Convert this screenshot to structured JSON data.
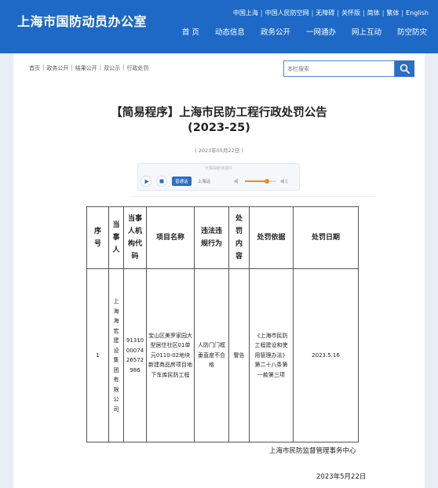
{
  "header": {
    "site_title": "上海市国防动员办公室",
    "top_links": [
      "中国上海",
      "中国人民防空网",
      "无障碍",
      "关怀版",
      "简体",
      "繁体",
      "English"
    ],
    "nav": [
      "首 页",
      "动态信息",
      "政务公开",
      "一网通办",
      "网上互动",
      "防空防灾"
    ]
  },
  "breadcrumb": [
    "首页",
    "政务公开",
    "结果公开",
    "双公示",
    "行政处罚"
  ],
  "search": {
    "placeholder": "本栏搜索",
    "icon": "search-icon"
  },
  "article": {
    "title_line1": "【简易程序】上海市民防工程行政处罚公告",
    "title_line2": "(2023-25)",
    "date": "( 2023年05月22日 )"
  },
  "audio_player": {
    "label": "无障碍朗读插件",
    "voices": [
      "普通话",
      "上海话"
    ],
    "selected_voice": "普通话",
    "volume": 0.7,
    "icons": [
      "play-icon",
      "stop-icon",
      "volume-low-icon",
      "volume-high-icon"
    ]
  },
  "table": {
    "headers": [
      "序号",
      "当事人",
      "当事人机构代码",
      "项目名称",
      "违法违规行为",
      "处罚内容",
      "处罚依据",
      "处罚日期"
    ],
    "rows": [
      [
        "1",
        "上海海宏建设集团有限公司",
        "91310000742657298​6",
        "宝山区美罗家园大型居住社区01单元0110-02地块新建商品房项目地下车库民防工程",
        "人防门门框垂直度不合格",
        "警告",
        "《上海市民防工程建设和使用管理办法》第二十八条第一款第三项",
        "2023.5.16"
      ]
    ]
  },
  "footer": {
    "org": "上海市民防监督管理事务中心",
    "date": "2023年5月22日"
  },
  "colors": {
    "header_bg": "#1e69c6",
    "page_bg": "#e9eef4",
    "accent": "#2d6fc0",
    "volume": "#f08c1a"
  }
}
